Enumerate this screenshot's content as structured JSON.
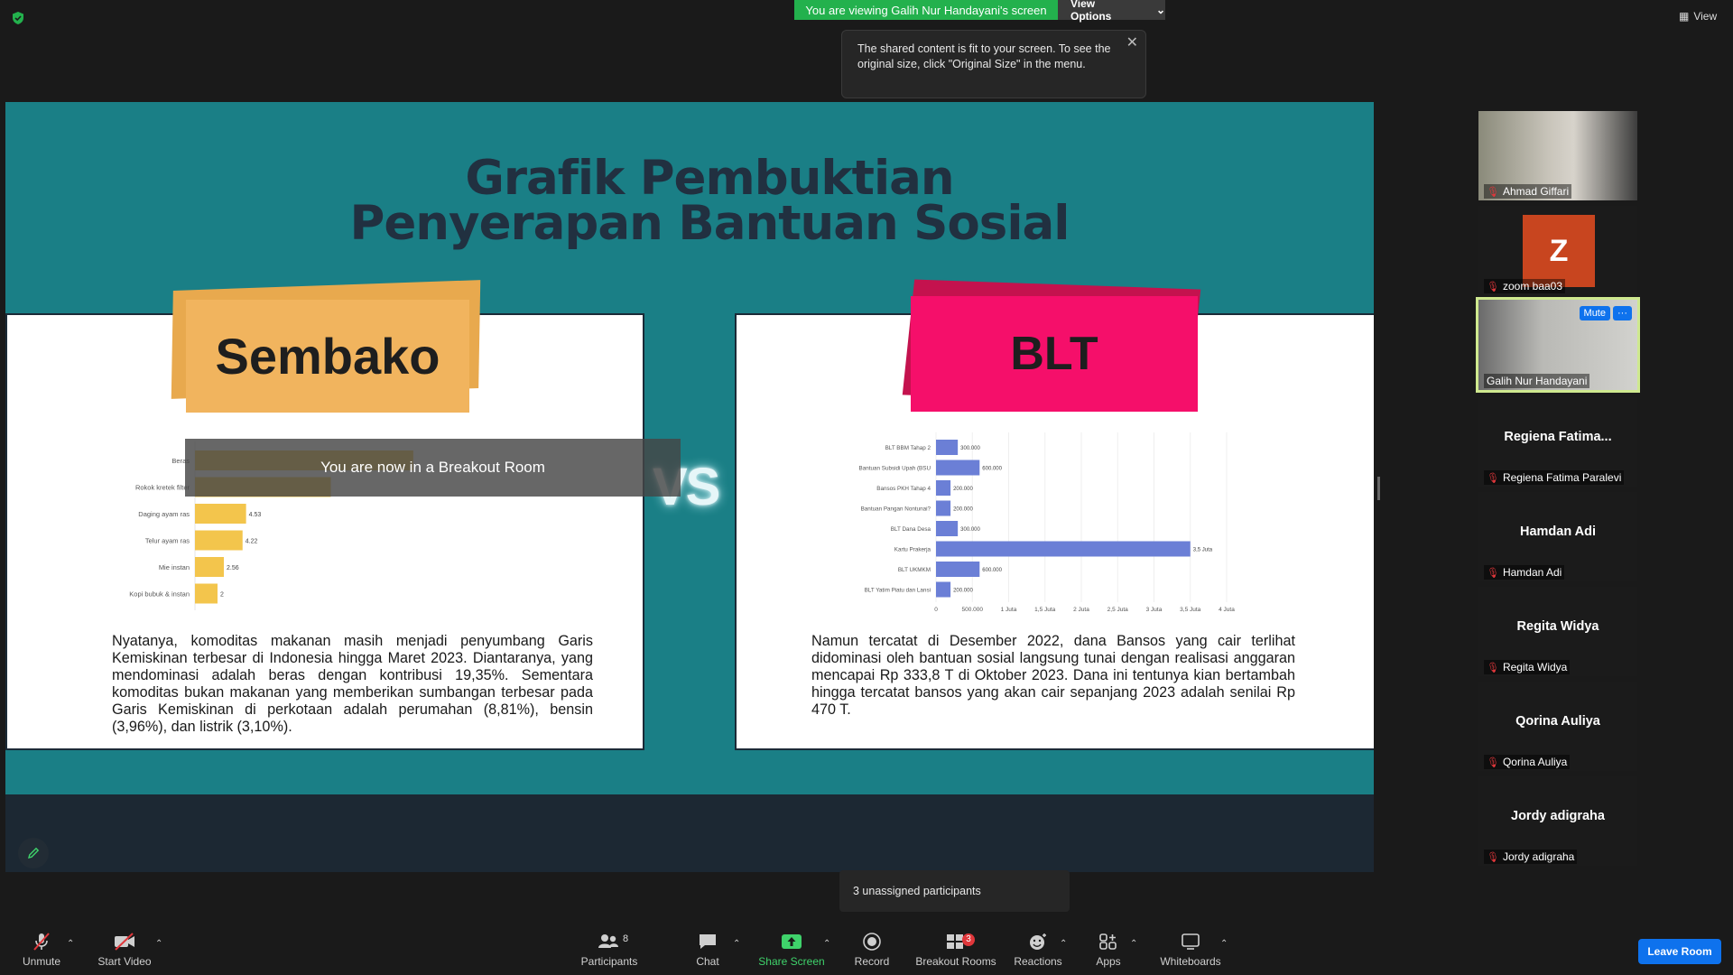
{
  "top": {
    "banner": "You are viewing Galih Nur Handayani's screen",
    "view_options": "View Options",
    "view": "View"
  },
  "tooltip": {
    "text": "The shared content is fit to your screen. To see the original size, click \"Original Size\" in the menu."
  },
  "slide": {
    "title_line1": "Grafik Pembuktian",
    "title_line2": "Penyerapan Bantuan Sosial",
    "left_tag": "Sembako",
    "right_tag": "BLT",
    "vs": "VS",
    "left_text": "Nyatanya, komoditas makanan masih menjadi penyumbang Garis Kemiskinan terbesar di Indonesia hingga Maret 2023. Diantaranya, yang mendominasi adalah beras dengan kontribusi 19,35%. Sementara komoditas bukan makanan yang memberikan sumbangan terbesar pada Garis Kemiskinan di perkotaan adalah perumahan (8,81%), bensin (3,96%), dan listrik (3,10%).",
    "right_text": "Namun tercatat di Desember 2022, dana Bansos yang cair terlihat didominasi oleh bantuan sosial langsung tunai dengan realisasi anggaran mencapai Rp 333,8 T di Oktober 2023. Dana ini tentunya kian bertambah hingga tercatat bansos yang akan cair sepanjang 2023 adalah senilai Rp 470 T."
  },
  "breakout_notice": "You are now in a Breakout Room",
  "unassigned": "3 unassigned participants",
  "chart_data": [
    {
      "type": "bar",
      "orientation": "horizontal",
      "categories": [
        "Beras",
        "Rokok kretek filter",
        "Daging ayam ras",
        "Telur ayam ras",
        "Mie instan",
        "Kopi bubuk & instan"
      ],
      "values": [
        19.35,
        12.04,
        4.53,
        4.22,
        2.56,
        2
      ],
      "labels": [
        "",
        "",
        "4.53",
        "4.22",
        "2.56",
        "2"
      ],
      "color": "#f3c54c"
    },
    {
      "type": "bar",
      "orientation": "horizontal",
      "categories": [
        "BLT BBM Tahap 2",
        "Bantuan Subsidi Upah (BSU",
        "Bansos PKH Tahap 4",
        "Bantuan Pangan Nontunai?",
        "BLT Dana Desa",
        "Kartu Prakerja",
        "BLT UKMKM",
        "BLT Yatim Piatu dan Lansi"
      ],
      "values": [
        300000,
        600000,
        200000,
        200000,
        300000,
        3500000,
        600000,
        200000
      ],
      "labels": [
        "300.000",
        "600.000",
        "200.000",
        "200.000",
        "300.000",
        "3,5 Juta",
        "600.000",
        "200.000"
      ],
      "xticks": [
        "0",
        "500.000",
        "1 Juta",
        "1,5 Juta",
        "2 Juta",
        "2,5 Juta",
        "3 Juta",
        "3,5 Juta",
        "4 Juta"
      ],
      "xlim": [
        0,
        4000000
      ],
      "color": "#6b7fd6"
    }
  ],
  "gallery": [
    {
      "name": "Ahmad Giffari"
    },
    {
      "name": "zoom baa03",
      "initial": "Z"
    },
    {
      "name": "Galih Nur Handayani",
      "mute": "Mute",
      "more": "···"
    },
    {
      "center": "Regiena  Fatima...",
      "name": "Regiena Fatima Paralevi"
    },
    {
      "center": "Hamdan Adi",
      "name": "Hamdan Adi"
    },
    {
      "center": "Regita Widya",
      "name": "Regita Widya"
    },
    {
      "center": "Qorina Auliya",
      "name": "Qorina Auliya"
    },
    {
      "center": "Jordy adigraha",
      "name": "Jordy adigraha"
    }
  ],
  "toolbar": {
    "unmute": "Unmute",
    "start_video": "Start Video",
    "participants": "Participants",
    "participants_count": "8",
    "chat": "Chat",
    "share_screen": "Share Screen",
    "record": "Record",
    "breakout_rooms": "Breakout Rooms",
    "breakout_badge": "3",
    "reactions": "Reactions",
    "apps": "Apps",
    "whiteboards": "Whiteboards",
    "leave_room": "Leave Room"
  }
}
